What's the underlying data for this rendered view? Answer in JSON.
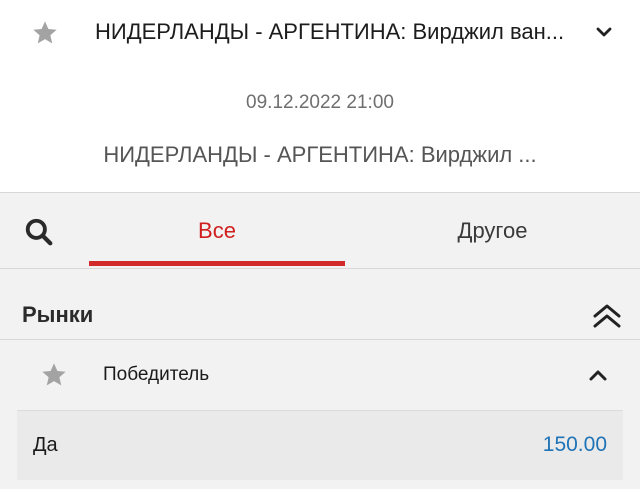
{
  "top_bar": {
    "title": "НИДЕРЛАНДЫ - АРГЕНТИНА: Вирджил ван...",
    "favorite_icon": "star-icon",
    "expand_icon": "chevron-down-icon"
  },
  "event": {
    "date": "09.12.2022 21:00",
    "name": "НИДЕРЛАНДЫ - АРГЕНТИНА: Вирджил ..."
  },
  "tabs": [
    {
      "label": "Все",
      "active": true
    },
    {
      "label": "Другое",
      "active": false
    }
  ],
  "markets": {
    "title": "Рынки",
    "items": [
      {
        "title": "Победитель",
        "outcomes": [
          {
            "name": "Да",
            "odds": "150.00"
          }
        ]
      }
    ]
  },
  "colors": {
    "accent_red": "#d22a2a",
    "odds_blue": "#1f73b7",
    "panel_gray": "#f2f2f2",
    "star_gray": "#9e9e9e"
  }
}
